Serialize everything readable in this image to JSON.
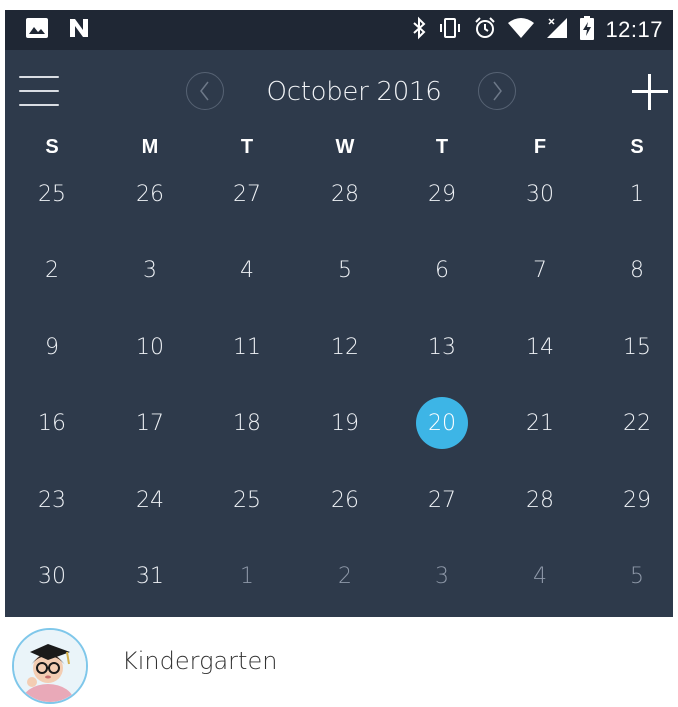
{
  "status_bar": {
    "time": "12:17",
    "left_icons": [
      "image-icon",
      "n-logo-icon"
    ],
    "right_icons": [
      "bluetooth-icon",
      "vibrate-icon",
      "alarm-icon",
      "wifi-icon",
      "no-signal-icon",
      "battery-charging-icon"
    ]
  },
  "header": {
    "month": "October 2016",
    "menu_icon": "hamburger-menu-icon",
    "prev_icon": "chevron-left-icon",
    "next_icon": "chevron-right-icon",
    "add_icon": "plus-icon"
  },
  "weekdays": [
    "S",
    "M",
    "T",
    "W",
    "T",
    "F",
    "S"
  ],
  "weeks": [
    [
      {
        "d": "25",
        "muted": false
      },
      {
        "d": "26",
        "muted": false
      },
      {
        "d": "27",
        "muted": false
      },
      {
        "d": "28",
        "muted": false
      },
      {
        "d": "29",
        "muted": false
      },
      {
        "d": "30",
        "muted": false
      },
      {
        "d": "1",
        "muted": false
      }
    ],
    [
      {
        "d": "2",
        "muted": false
      },
      {
        "d": "3",
        "muted": false
      },
      {
        "d": "4",
        "muted": false
      },
      {
        "d": "5",
        "muted": false
      },
      {
        "d": "6",
        "muted": false
      },
      {
        "d": "7",
        "muted": false
      },
      {
        "d": "8",
        "muted": false
      }
    ],
    [
      {
        "d": "9",
        "muted": false
      },
      {
        "d": "10",
        "muted": false
      },
      {
        "d": "11",
        "muted": false
      },
      {
        "d": "12",
        "muted": false
      },
      {
        "d": "13",
        "muted": false
      },
      {
        "d": "14",
        "muted": false
      },
      {
        "d": "15",
        "muted": false
      }
    ],
    [
      {
        "d": "16",
        "muted": false
      },
      {
        "d": "17",
        "muted": false
      },
      {
        "d": "18",
        "muted": false
      },
      {
        "d": "19",
        "muted": false
      },
      {
        "d": "20",
        "muted": false,
        "selected": true
      },
      {
        "d": "21",
        "muted": false
      },
      {
        "d": "22",
        "muted": false
      }
    ],
    [
      {
        "d": "23",
        "muted": false
      },
      {
        "d": "24",
        "muted": false
      },
      {
        "d": "25",
        "muted": false
      },
      {
        "d": "26",
        "muted": false
      },
      {
        "d": "27",
        "muted": false
      },
      {
        "d": "28",
        "muted": false
      },
      {
        "d": "29",
        "muted": false
      }
    ],
    [
      {
        "d": "30",
        "muted": false
      },
      {
        "d": "31",
        "muted": false
      },
      {
        "d": "1",
        "muted": true
      },
      {
        "d": "2",
        "muted": true
      },
      {
        "d": "3",
        "muted": true
      },
      {
        "d": "4",
        "muted": true
      },
      {
        "d": "5",
        "muted": true
      }
    ]
  ],
  "profile": {
    "name": "Kindergarten",
    "avatar_icon": "child-avatar-icon"
  },
  "colors": {
    "status_bar_bg": "#1f2734",
    "calendar_bg": "#2e3a4b",
    "selected_day": "#3db5e6",
    "muted_day": "#8e98a8",
    "avatar_border": "#7fc7ea"
  }
}
